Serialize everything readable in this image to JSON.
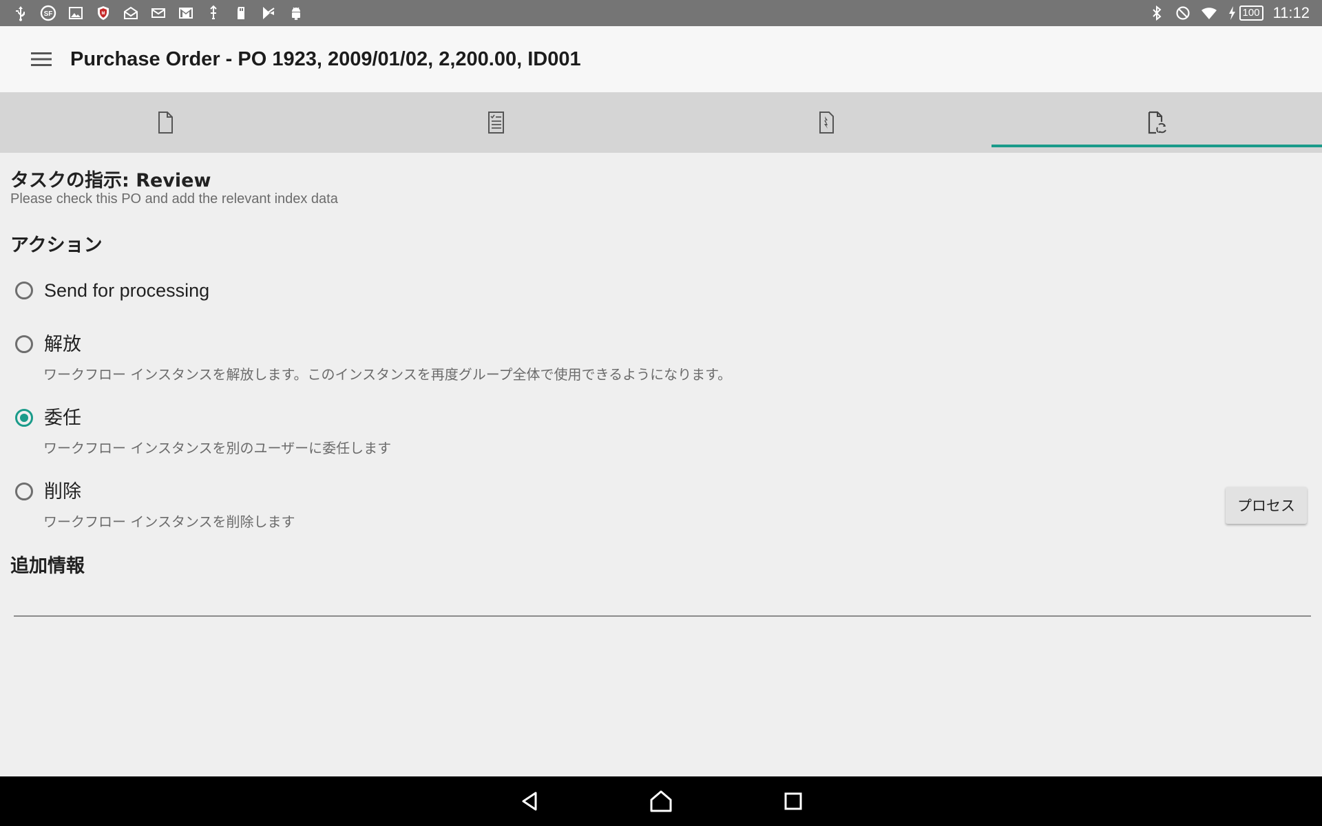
{
  "status_bar": {
    "left_icons": [
      "usb-icon",
      "sf-icon",
      "image-icon",
      "mcafee-icon",
      "mail-open-icon",
      "mail-icon",
      "gmail-icon",
      "usb-debug-icon",
      "sd-card-icon",
      "play-store-icon",
      "android-icon"
    ],
    "right_icons": [
      "bluetooth-icon",
      "do-not-disturb-icon",
      "wifi-icon",
      "charging-icon"
    ],
    "battery": "100",
    "time": "11:12"
  },
  "app_bar": {
    "title": "Purchase Order - PO 1923, 2009/01/02, 2,200.00, ID001"
  },
  "tabs": [
    {
      "icon": "document-icon",
      "active": false
    },
    {
      "icon": "index-list-icon",
      "active": false
    },
    {
      "icon": "document-history-icon",
      "active": false
    },
    {
      "icon": "document-workflow-icon",
      "active": true
    }
  ],
  "task": {
    "heading": "タスクの指示: Review",
    "description": "Please check this PO and add the relevant index data"
  },
  "actions": {
    "heading": "アクション",
    "options": [
      {
        "label": "Send for processing",
        "description": "",
        "checked": false
      },
      {
        "label": "解放",
        "description": "ワークフロー インスタンスを解放します。このインスタンスを再度グループ全体で使用できるようになります。",
        "checked": false
      },
      {
        "label": "委任",
        "description": "ワークフロー インスタンスを別のユーザーに委任します",
        "checked": true
      },
      {
        "label": "削除",
        "description": "ワークフロー インスタンスを削除します",
        "checked": false
      }
    ],
    "process_button": "プロセス"
  },
  "additional_info": {
    "heading": "追加情報",
    "value": ""
  },
  "colors": {
    "accent": "#1a9b8a",
    "status_bar": "#757575",
    "tab_bar": "#d5d5d5",
    "background": "#efefef"
  },
  "nav_bar": {
    "buttons": [
      "back-icon",
      "home-icon",
      "recents-icon"
    ]
  }
}
